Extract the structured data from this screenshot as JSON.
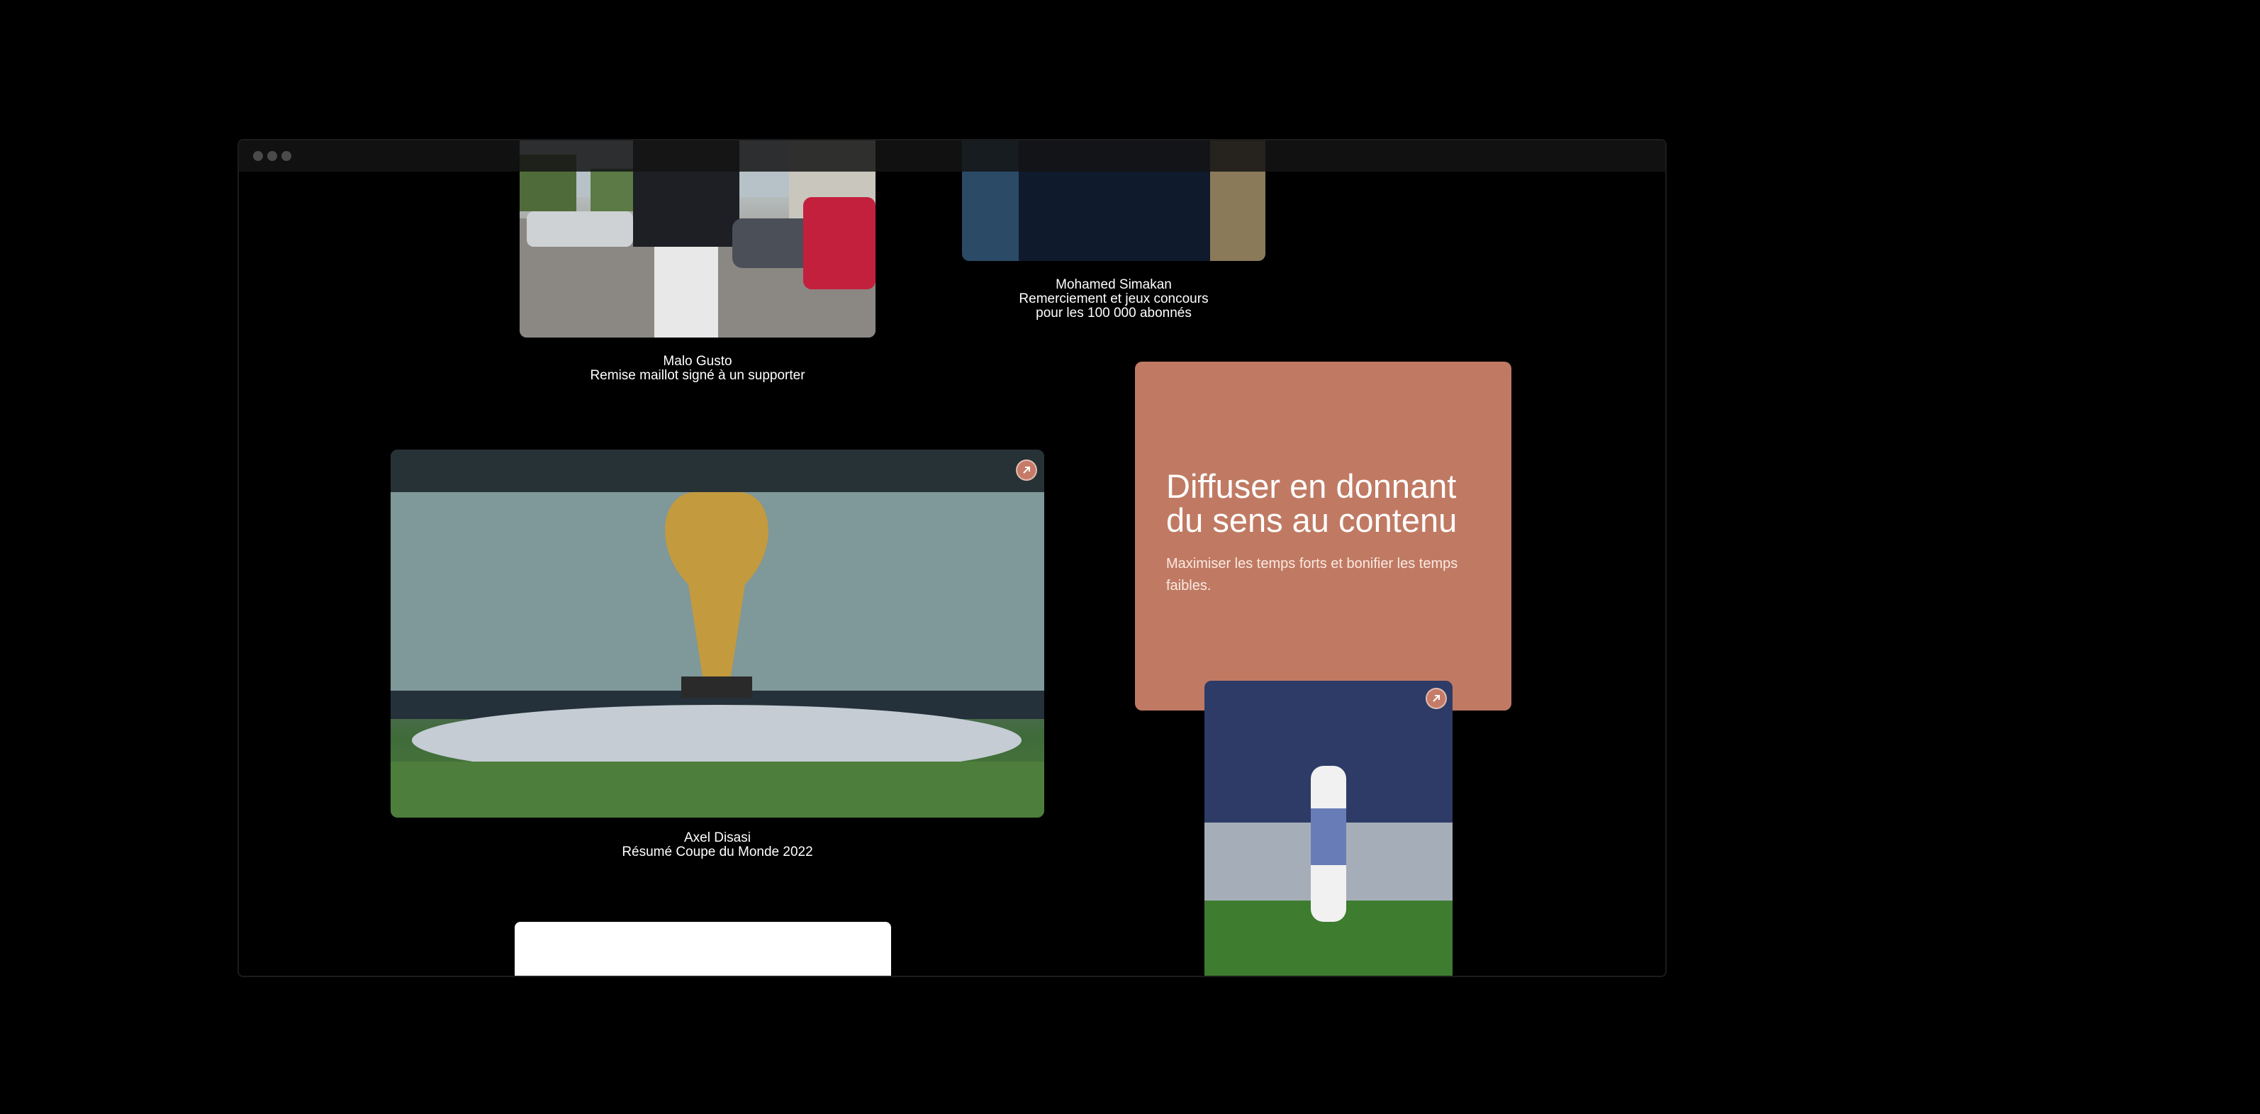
{
  "window": {
    "controls": [
      "dot",
      "dot",
      "dot"
    ]
  },
  "items": [
    {
      "name": "Malo Gusto",
      "subtitle": "Remise maillot signé à un supporter"
    },
    {
      "name": "Mohamed Simakan",
      "subtitle_line1": "Remerciement et jeux concours",
      "subtitle_line2": "pour les 100 000 abonnés"
    },
    {
      "name": "Axel Disasi",
      "subtitle": "Résumé Coupe du Monde 2022"
    }
  ],
  "promo": {
    "title": "Diffuser en donnant du sens au contenu",
    "text": "Maximiser les temps forts et bonifier les temps faibles.",
    "background": "#c07a63"
  },
  "icons": {
    "external_link": "arrow-up-right-icon"
  }
}
